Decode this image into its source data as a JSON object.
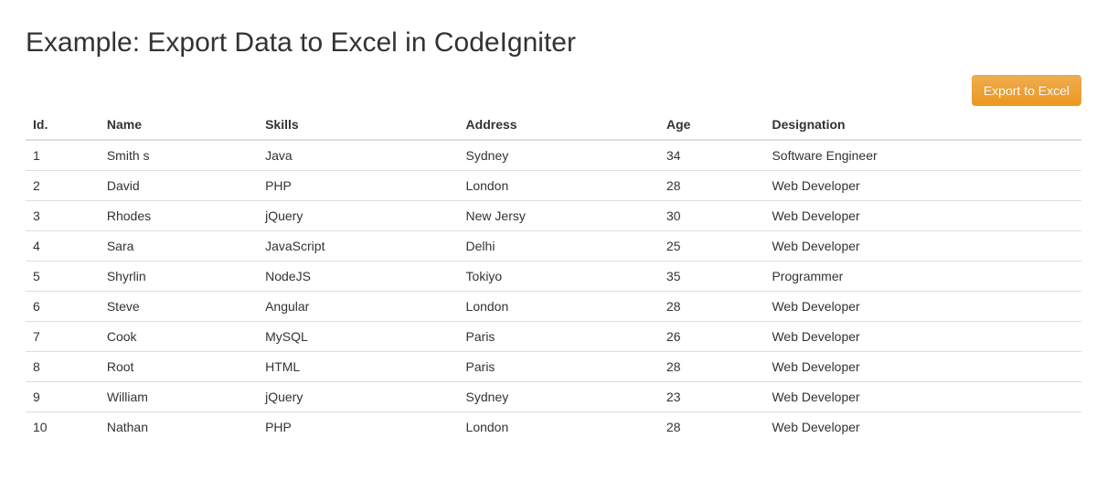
{
  "title": "Example: Export Data to Excel in CodeIgniter",
  "toolbar": {
    "export_label": "Export to Excel"
  },
  "table": {
    "headers": {
      "id": "Id.",
      "name": "Name",
      "skills": "Skills",
      "address": "Address",
      "age": "Age",
      "designation": "Designation"
    },
    "rows": [
      {
        "id": "1",
        "name": "Smith s",
        "skills": "Java",
        "address": "Sydney",
        "age": "34",
        "designation": "Software Engineer"
      },
      {
        "id": "2",
        "name": "David",
        "skills": "PHP",
        "address": "London",
        "age": "28",
        "designation": "Web Developer"
      },
      {
        "id": "3",
        "name": "Rhodes",
        "skills": "jQuery",
        "address": "New Jersy",
        "age": "30",
        "designation": "Web Developer"
      },
      {
        "id": "4",
        "name": "Sara",
        "skills": "JavaScript",
        "address": "Delhi",
        "age": "25",
        "designation": "Web Developer"
      },
      {
        "id": "5",
        "name": "Shyrlin",
        "skills": "NodeJS",
        "address": "Tokiyo",
        "age": "35",
        "designation": "Programmer"
      },
      {
        "id": "6",
        "name": "Steve",
        "skills": "Angular",
        "address": "London",
        "age": "28",
        "designation": "Web Developer"
      },
      {
        "id": "7",
        "name": "Cook",
        "skills": "MySQL",
        "address": "Paris",
        "age": "26",
        "designation": "Web Developer"
      },
      {
        "id": "8",
        "name": "Root",
        "skills": "HTML",
        "address": "Paris",
        "age": "28",
        "designation": "Web Developer"
      },
      {
        "id": "9",
        "name": "William",
        "skills": "jQuery",
        "address": "Sydney",
        "age": "23",
        "designation": "Web Developer"
      },
      {
        "id": "10",
        "name": "Nathan",
        "skills": "PHP",
        "address": "London",
        "age": "28",
        "designation": "Web Developer"
      }
    ]
  }
}
